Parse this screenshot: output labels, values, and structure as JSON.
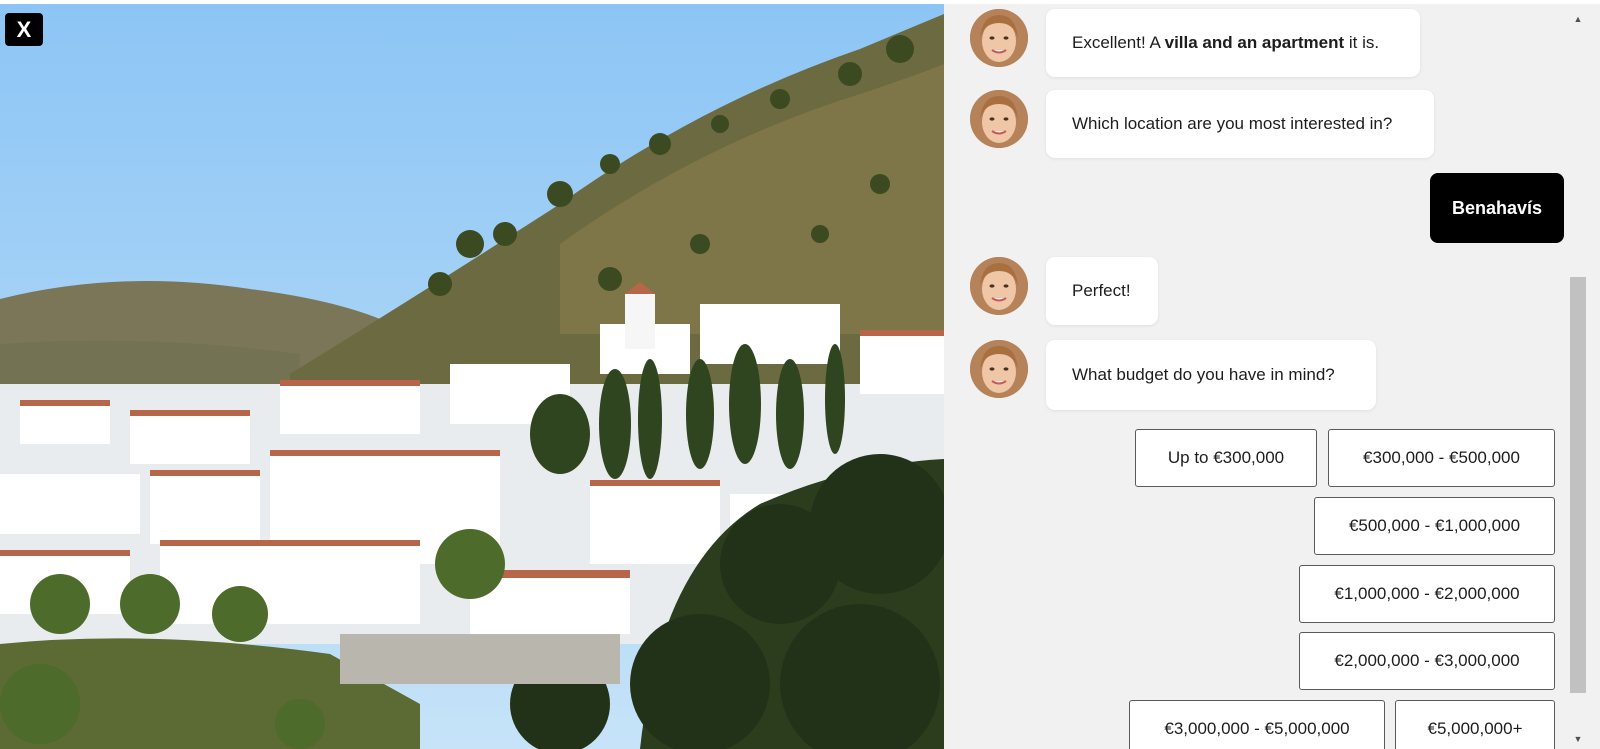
{
  "close_button": {
    "label": "X"
  },
  "chat": {
    "messages": [
      {
        "pre": "Excellent! A ",
        "bold": "villa and an apartment",
        "post": " it is."
      },
      {
        "text": "Which location are you most interested in?"
      },
      {
        "text": "Perfect!"
      },
      {
        "text": "What budget do you have in mind?"
      }
    ],
    "user_reply": "Benahavís",
    "options": [
      "Up to €300,000",
      "€300,000 - €500,000",
      "€500,000 - €1,000,000",
      "€1,000,000 - €2,000,000",
      "€2,000,000 - €3,000,000",
      "€3,000,000 - €5,000,000",
      "€5,000,000+"
    ]
  },
  "colors": {
    "chat_background": "#f1f1f1",
    "user_bubble": "#000000",
    "bot_bubble": "#ffffff",
    "sky": "#9fcdf3"
  },
  "icons": {
    "scroll_up": "triangle-up-icon",
    "scroll_down": "triangle-down-icon"
  }
}
